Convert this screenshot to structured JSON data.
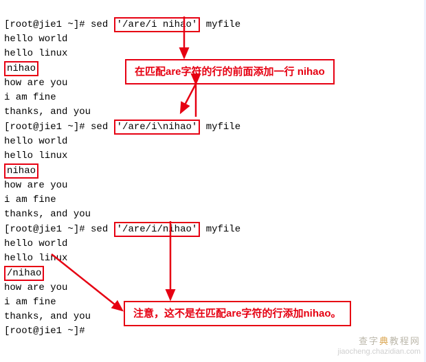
{
  "prompt": "[root@jie1 ~]#",
  "cmd": "sed",
  "arg1": "'/are/i nihao'",
  "arg2": "'/are/i\\nihao'",
  "arg3": "'/are/i/nihao'",
  "file": "myfile",
  "out": {
    "l1": "hello world",
    "l2": "hello linux",
    "nihao": "nihao",
    "slash_nihao": "/nihao",
    "l3": "how are you",
    "l4": "i am fine",
    "l5": "thanks, and you"
  },
  "annotation1": "在匹配are字符的行的前面添加一行 nihao",
  "annotation2": "注意，这不是在匹配are字符的行添加nihao。",
  "watermark_cn_a": "查字",
  "watermark_cn_b": "典",
  "watermark_cn_c": "教程网",
  "watermark_en": "jiaocheng.chazidian.com"
}
